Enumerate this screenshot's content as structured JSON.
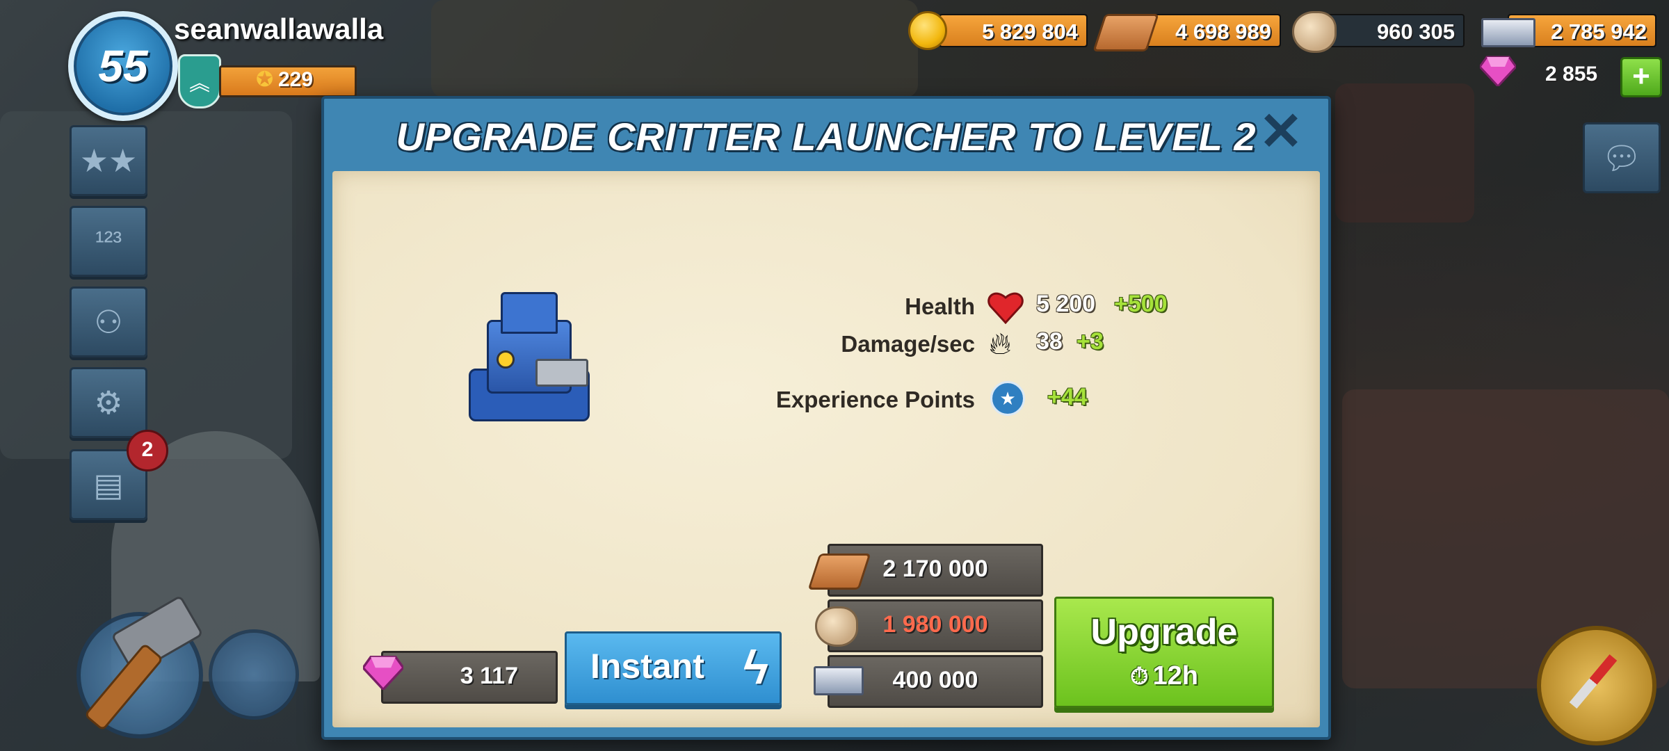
{
  "player": {
    "level": "55",
    "name": "seanwallawalla",
    "medals": "229"
  },
  "resources": {
    "gold": "5 829 804",
    "wood": "4 698 989",
    "stone": "960 305",
    "iron": "2 785 942",
    "diamonds": "2 855",
    "add_label": "+"
  },
  "side_menu": {
    "notifications_count": "2"
  },
  "dialog": {
    "title": "Upgrade Critter Launcher to Level 2",
    "close_label": "✕",
    "stats": [
      {
        "label": "Health",
        "value": "5 200",
        "increase": "+500",
        "icon": "heart-icon"
      },
      {
        "label": "Damage/sec",
        "value": "38",
        "increase": "+3",
        "icon": "fire-icon"
      },
      {
        "label": "Experience Points",
        "value": "",
        "increase": "+44",
        "icon": "xp-star-icon"
      }
    ],
    "costs": [
      {
        "resource": "wood",
        "amount": "2 170 000",
        "insufficient": false
      },
      {
        "resource": "stone",
        "amount": "1 980 000",
        "insufficient": true
      },
      {
        "resource": "iron",
        "amount": "400 000",
        "insufficient": false
      }
    ],
    "instant": {
      "diamond_cost": "3 117",
      "label": "Instant",
      "icon": "lightning-icon"
    },
    "upgrade": {
      "label": "Upgrade",
      "time": "12h",
      "icon": "stopwatch-icon"
    }
  },
  "colors": {
    "dialog_frame": "#3f86b3",
    "upgrade_green": "#6cc21e",
    "instant_blue": "#2f8fd0",
    "insufficient_red": "#ff6a4d",
    "stat_increase_green": "#a6e23a"
  }
}
